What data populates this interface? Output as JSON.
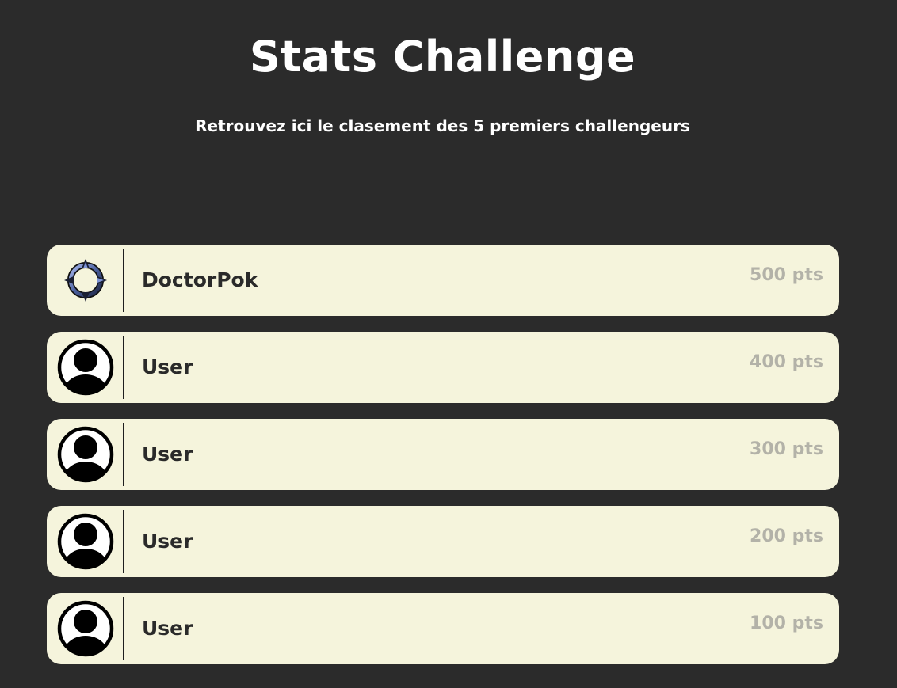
{
  "header": {
    "title": "Stats Challenge",
    "subtitle": "Retrouvez ici le clasement des 5 premiers challengeurs"
  },
  "leaderboard": [
    {
      "name": "DoctorPok",
      "points": "500 pts",
      "avatar": "crosshair-icon"
    },
    {
      "name": "User",
      "points": "400 pts",
      "avatar": "user-avatar-icon"
    },
    {
      "name": "User",
      "points": "300 pts",
      "avatar": "user-avatar-icon"
    },
    {
      "name": "User",
      "points": "200 pts",
      "avatar": "user-avatar-icon"
    },
    {
      "name": "User",
      "points": "100 pts",
      "avatar": "user-avatar-icon"
    }
  ],
  "colors": {
    "background": "#2b2b2b",
    "card": "#f5f4dc",
    "text_dark": "#2a2a2a",
    "points": "#b3b2a8",
    "accent_blue": "#5a7fd6"
  }
}
